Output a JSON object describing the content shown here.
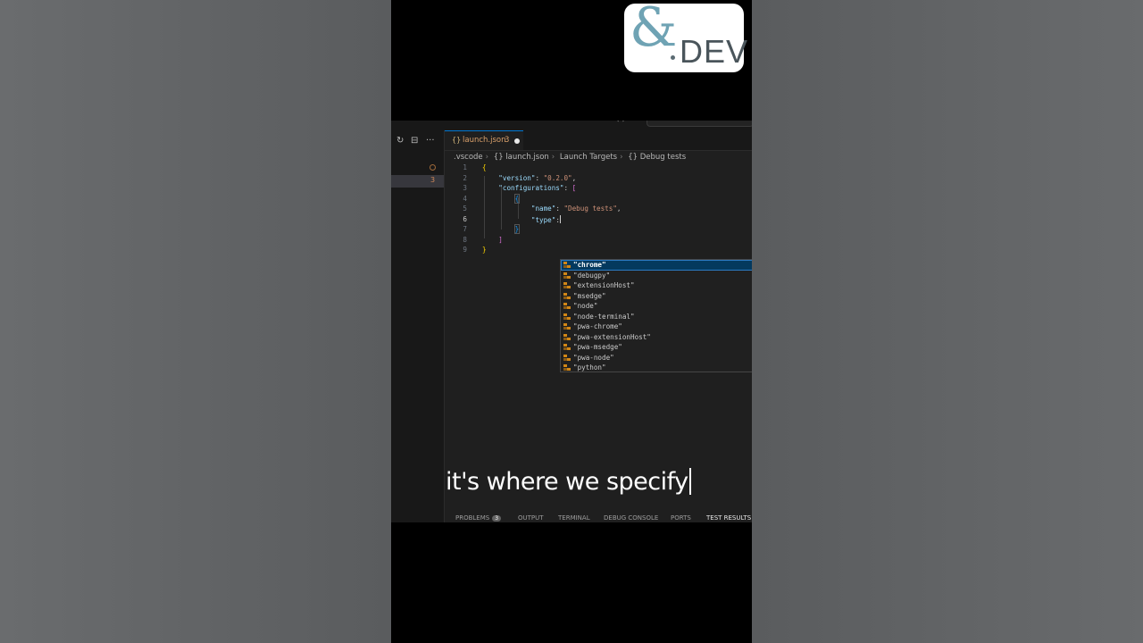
{
  "logo": {
    "symbol": "&",
    "text": "DEV"
  },
  "window": {
    "nav_arrows": "‹ ›"
  },
  "sidebar": {
    "icons": [
      "refresh-icon",
      "collapse-all-icon",
      "more-icon"
    ],
    "glyphs": [
      "↻",
      "⊟",
      "···"
    ],
    "problem_count": "3"
  },
  "tab": {
    "icon": "{}",
    "label": "launch.json",
    "problem_count": "3"
  },
  "breadcrumb": {
    "items": [
      ".vscode",
      "{} launch.json",
      "Launch Targets",
      "{} Debug tests"
    ]
  },
  "editor": {
    "active_line": 6,
    "lines": [
      {
        "n": "1"
      },
      {
        "n": "2",
        "key": "\"version\"",
        "value": "\"0.2.0\""
      },
      {
        "n": "3",
        "key": "\"configurations\""
      },
      {
        "n": "4"
      },
      {
        "n": "5",
        "key": "\"name\"",
        "value": "\"Debug tests\""
      },
      {
        "n": "6",
        "key": "\"type\""
      },
      {
        "n": "7"
      },
      {
        "n": "8"
      },
      {
        "n": "9"
      }
    ]
  },
  "suggestions": {
    "selected_index": 0,
    "icon": "enum-member-icon",
    "items": [
      "\"chrome\"",
      "\"debugpy\"",
      "\"extensionHost\"",
      "\"msedge\"",
      "\"node\"",
      "\"node-terminal\"",
      "\"pwa-chrome\"",
      "\"pwa-extensionHost\"",
      "\"pwa-msedge\"",
      "\"pwa-node\"",
      "\"python\""
    ]
  },
  "panel": {
    "tabs": [
      "PROBLEMS",
      "OUTPUT",
      "TERMINAL",
      "DEBUG CONSOLE",
      "PORTS",
      "TEST RESULTS"
    ],
    "problems_badge": "3",
    "active_tab": "TEST RESULTS"
  },
  "caption": {
    "text": "it's where we specify"
  },
  "colors": {
    "editor_bg": "#1f1f1f",
    "selection": "#04395e",
    "string": "#ce9178",
    "key": "#9cdcfe",
    "warning": "#d9a06b"
  }
}
